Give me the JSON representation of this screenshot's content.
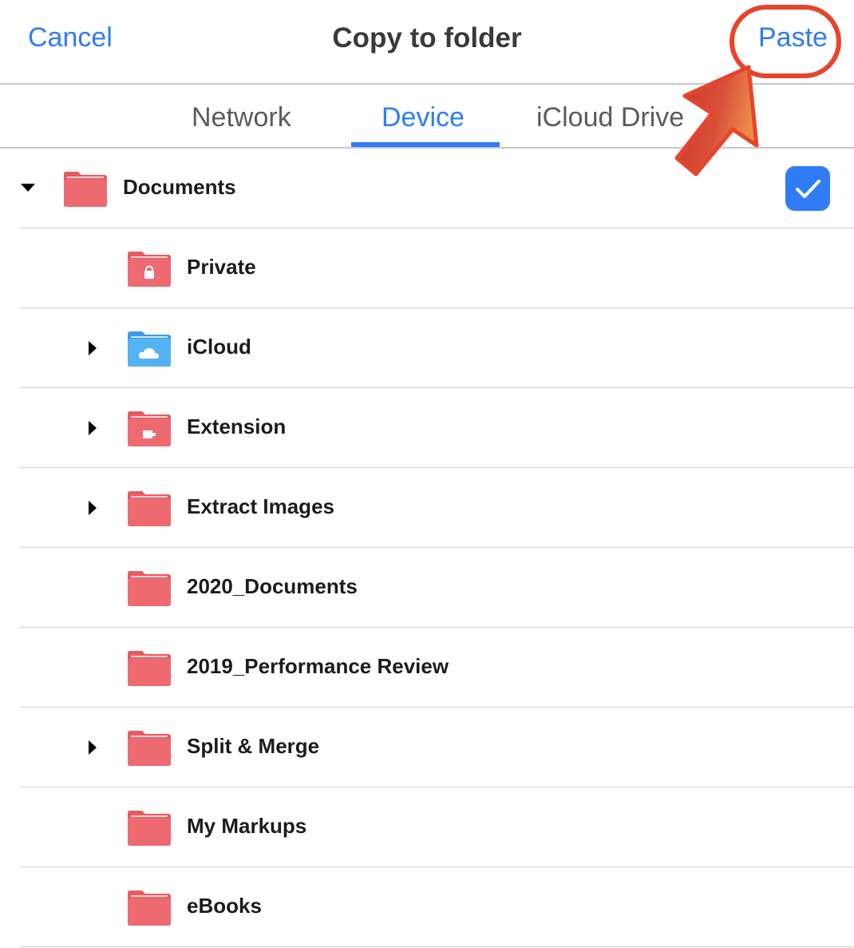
{
  "navbar": {
    "cancel_label": "Cancel",
    "title": "Copy to folder",
    "paste_label": "Paste"
  },
  "tabs": [
    {
      "label": "Network",
      "selected": false
    },
    {
      "label": "Device",
      "selected": true
    },
    {
      "label": "iCloud Drive",
      "selected": false
    }
  ],
  "colors": {
    "accent": "#2f7cf6",
    "folder_red": "#e85a62",
    "folder_blue": "#4aa8f0",
    "annotation": "#e8442b"
  },
  "root": {
    "label": "Documents",
    "expanded": true,
    "checked": true,
    "icon": "folder-icon"
  },
  "folders": [
    {
      "label": "Private",
      "has_children": false,
      "icon": "lock-folder-icon"
    },
    {
      "label": "iCloud",
      "has_children": true,
      "icon": "cloud-folder-icon"
    },
    {
      "label": "Extension",
      "has_children": true,
      "icon": "extension-folder-icon"
    },
    {
      "label": "Extract Images",
      "has_children": true,
      "icon": "folder-icon"
    },
    {
      "label": "2020_Documents",
      "has_children": false,
      "icon": "folder-icon"
    },
    {
      "label": "2019_Performance Review",
      "has_children": false,
      "icon": "folder-icon"
    },
    {
      "label": "Split & Merge",
      "has_children": true,
      "icon": "folder-icon"
    },
    {
      "label": "My Markups",
      "has_children": false,
      "icon": "folder-icon"
    },
    {
      "label": "eBooks",
      "has_children": false,
      "icon": "folder-icon"
    }
  ]
}
